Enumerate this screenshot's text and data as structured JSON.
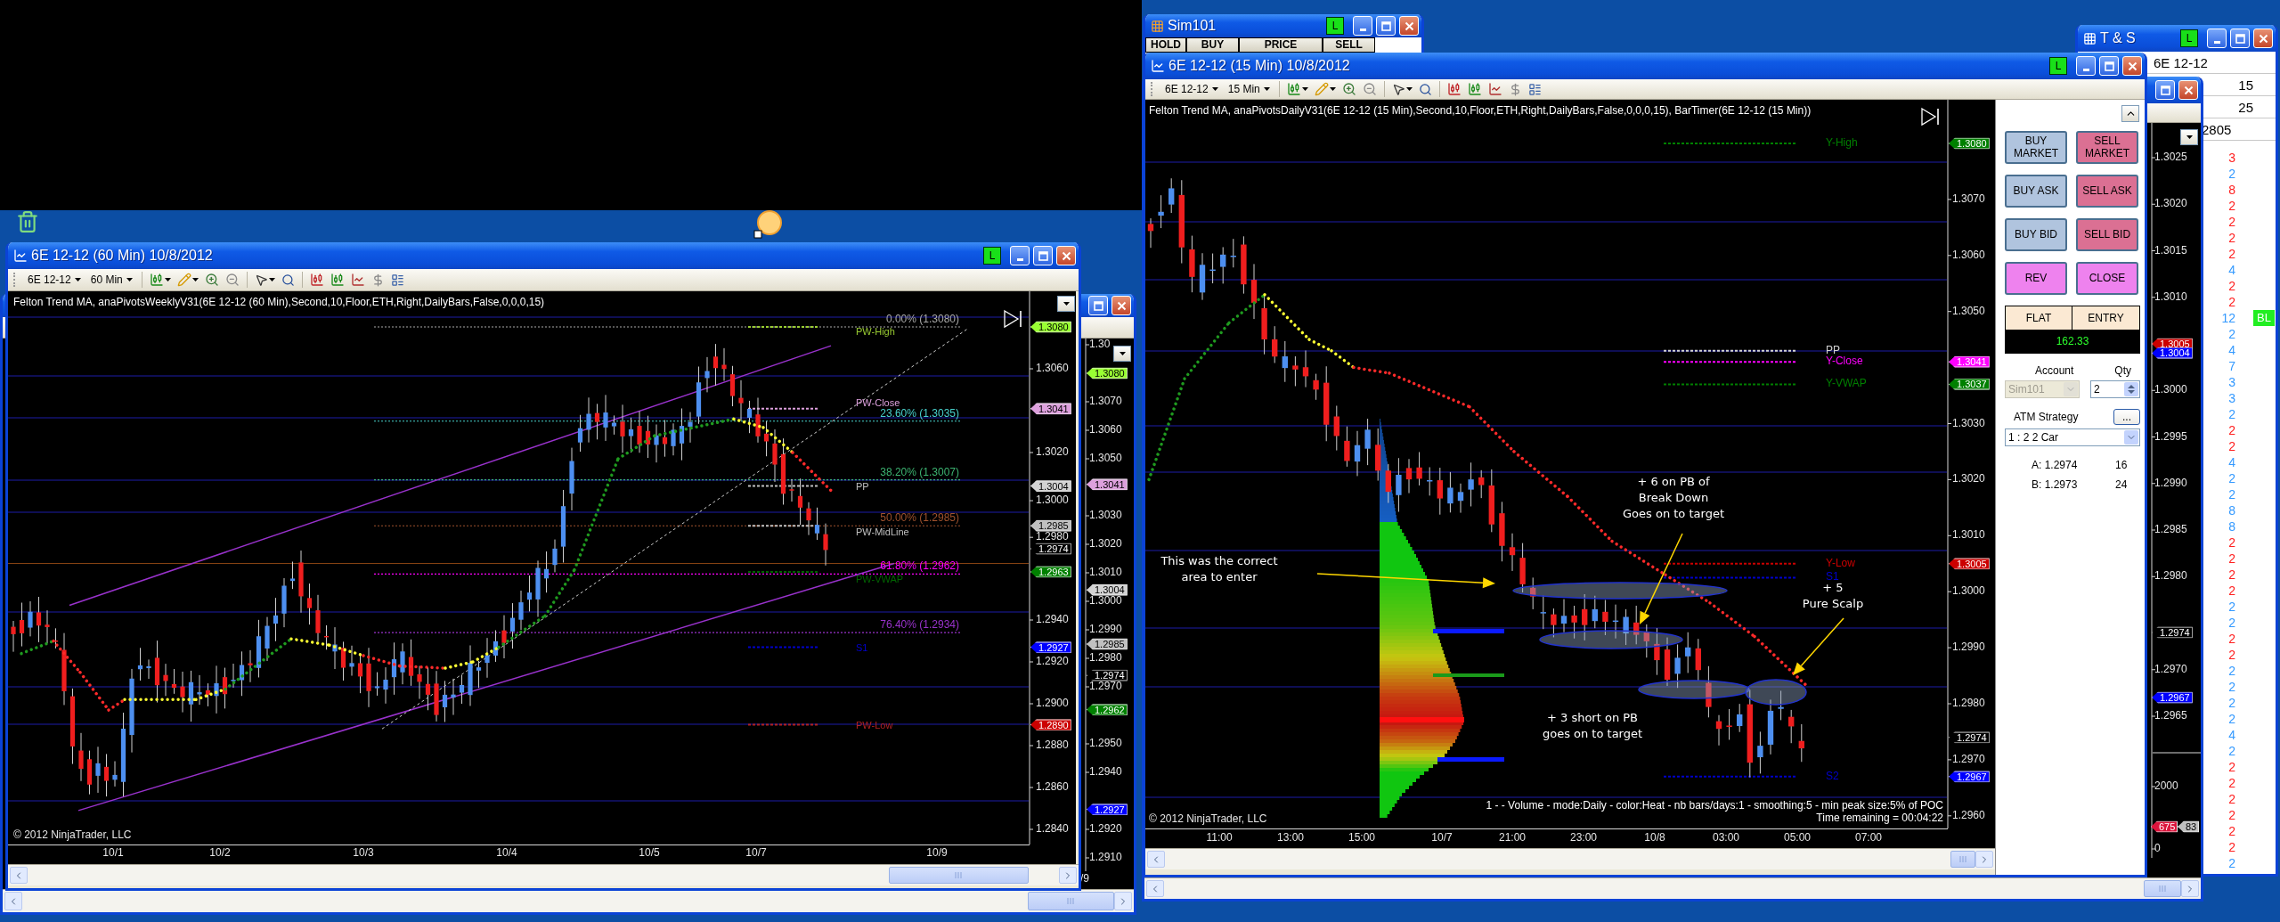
{
  "sim101_window": {
    "title": "Sim101",
    "status": "L",
    "columns": [
      "HOLD",
      "BUY",
      "PRICE",
      "SELL"
    ]
  },
  "right_chart_window": {
    "title": "6E 12-12 (15 Min)  10/8/2012",
    "status": "L",
    "instrument": "6E 12-12",
    "interval": "15 Min",
    "indicators": "Felton Trend MA, anaPivotsDailyV31(6E 12-12 (15 Min),Second,10,Floor,ETH,Right,DailyBars,False,0,0,0,15), BarTimer(6E 12-12 (15 Min))",
    "y_ticks": [
      "1.3070",
      "1.3060",
      "1.3050",
      "1.3030",
      "1.3020",
      "1.3010",
      "1.3000",
      "1.2990",
      "1.2980",
      "1.2970",
      "1.2960"
    ],
    "x_ticks": [
      "11:00",
      "13:00",
      "15:00",
      "10/7",
      "21:00",
      "23:00",
      "10/8",
      "03:00",
      "05:00",
      "07:00"
    ],
    "price_tags": [
      {
        "text": "1.3080",
        "color": "#008000"
      },
      {
        "text": "1.3041",
        "color": "#ff00ff"
      },
      {
        "text": "1.3037",
        "color": "#008000"
      },
      {
        "text": "1.3005",
        "color": "#cc0000"
      },
      {
        "text": "1.2974",
        "color": "#000000"
      },
      {
        "text": "1.2967",
        "color": "#0000ff"
      }
    ],
    "level_labels": [
      {
        "text": "Y-High",
        "color": "#008000"
      },
      {
        "text": "PP",
        "color": "#d3d3d3"
      },
      {
        "text": "Y-Close",
        "color": "#ff00ff"
      },
      {
        "text": "Y-VWAP",
        "color": "#008000"
      },
      {
        "text": "Y-Low",
        "color": "#cc0000"
      },
      {
        "text": "S1",
        "color": "#0000cd"
      },
      {
        "text": "S2",
        "color": "#0000cd"
      }
    ],
    "annotations": [
      "This was the correct\narea to enter",
      "+ 6 on PB of\nBreak Down\nGoes on to target",
      "+ 5\nPure Scalp",
      "+ 3 short on PB\ngoes on to target"
    ],
    "volume_legend": "1 -  - Volume - mode:Daily - color:Heat - nb bars/days:1 - smoothing:5 - min peak size:5% of POC",
    "time_remaining": "Time remaining = 00:04:22",
    "copyright": "© 2012 NinjaTrader, LLC",
    "order_panel": {
      "buttons": [
        {
          "label": "BUY MARKET",
          "color": "#b0c4de"
        },
        {
          "label": "SELL MARKET",
          "color": "#db7093"
        },
        {
          "label": "BUY ASK",
          "color": "#b0c4de"
        },
        {
          "label": "SELL ASK",
          "color": "#db7093"
        },
        {
          "label": "BUY BID",
          "color": "#b0c4de"
        },
        {
          "label": "SELL BID",
          "color": "#db7093"
        },
        {
          "label": "REV",
          "color": "#ee82ee"
        },
        {
          "label": "CLOSE",
          "color": "#ee82ee"
        }
      ],
      "position": "FLAT",
      "entry_label": "ENTRY",
      "pnl": "162.33",
      "account_label": "Account",
      "qty_label": "Qty",
      "account": {
        "value": "Sim101",
        "disabled": true
      },
      "qty": "2",
      "atm_label": "ATM Strategy",
      "atm_more": "...",
      "atm_strategy": "1 : 2  2 Car",
      "quotes": [
        {
          "label": "A: 1.2974",
          "size": "16"
        },
        {
          "label": "B: 1.2973",
          "size": "24"
        }
      ]
    }
  },
  "middle_chart_window": {
    "y_ticks": [
      "1.3025",
      "1.3020",
      "1.3015",
      "1.3010",
      "1.3000",
      "1.2995",
      "1.2990",
      "1.2985",
      "1.2980",
      "1.2970",
      "1.2965"
    ],
    "price_tags": [
      {
        "text": "1.3005",
        "color": "#cc0000"
      },
      {
        "text": "1.3004",
        "color": "#0000ff"
      },
      {
        "text": "1.2974",
        "color": "#000000"
      },
      {
        "text": "1.2967",
        "color": "#0000ff"
      }
    ],
    "volume_ticks": [
      "2000",
      "0"
    ],
    "volume_tags": [
      {
        "text": "675",
        "color": "#dc143c"
      },
      {
        "text": "83",
        "color": "#c0c0c0"
      }
    ]
  },
  "time_and_sales_window": {
    "title": "T & S",
    "status": "L",
    "instrument": "6E 12-12",
    "rows": [
      "15",
      "25"
    ],
    "last": "2805",
    "trades": [
      {
        "size": "3",
        "color": "#ff2020"
      },
      {
        "size": "2",
        "color": "#3399ff"
      },
      {
        "size": "8",
        "color": "#ff2020"
      },
      {
        "size": "2",
        "color": "#ff2020"
      },
      {
        "size": "2",
        "color": "#ff2020"
      },
      {
        "size": "2",
        "color": "#ff2020"
      },
      {
        "size": "2",
        "color": "#ff2020"
      },
      {
        "size": "4",
        "color": "#3399ff"
      },
      {
        "size": "2",
        "color": "#ff2020"
      },
      {
        "size": "2",
        "color": "#ff2020"
      },
      {
        "size": "12",
        "color": "#3399ff",
        "badge": "BL"
      },
      {
        "size": "2",
        "color": "#3399ff"
      },
      {
        "size": "4",
        "color": "#3399ff"
      },
      {
        "size": "7",
        "color": "#3399ff"
      },
      {
        "size": "3",
        "color": "#3399ff"
      },
      {
        "size": "3",
        "color": "#3399ff"
      },
      {
        "size": "2",
        "color": "#3399ff"
      },
      {
        "size": "2",
        "color": "#ff2020"
      },
      {
        "size": "2",
        "color": "#ff2020"
      },
      {
        "size": "4",
        "color": "#3399ff"
      },
      {
        "size": "2",
        "color": "#3399ff"
      },
      {
        "size": "2",
        "color": "#3399ff"
      },
      {
        "size": "8",
        "color": "#3399ff"
      },
      {
        "size": "8",
        "color": "#3399ff"
      },
      {
        "size": "2",
        "color": "#ff2020"
      },
      {
        "size": "2",
        "color": "#ff2020"
      },
      {
        "size": "2",
        "color": "#ff2020"
      },
      {
        "size": "2",
        "color": "#ff2020"
      },
      {
        "size": "2",
        "color": "#3399ff"
      },
      {
        "size": "2",
        "color": "#3399ff"
      },
      {
        "size": "2",
        "color": "#ff2020"
      },
      {
        "size": "2",
        "color": "#ff2020"
      },
      {
        "size": "2",
        "color": "#3399ff"
      },
      {
        "size": "2",
        "color": "#3399ff"
      },
      {
        "size": "2",
        "color": "#3399ff"
      },
      {
        "size": "2",
        "color": "#3399ff"
      },
      {
        "size": "4",
        "color": "#3399ff"
      },
      {
        "size": "2",
        "color": "#3399ff"
      },
      {
        "size": "2",
        "color": "#ff2020"
      },
      {
        "size": "2",
        "color": "#ff2020"
      },
      {
        "size": "2",
        "color": "#ff2020"
      },
      {
        "size": "2",
        "color": "#ff2020"
      },
      {
        "size": "2",
        "color": "#ff2020"
      },
      {
        "size": "2",
        "color": "#ff2020"
      },
      {
        "size": "2",
        "color": "#3399ff"
      }
    ]
  },
  "left_chart_window": {
    "title": "6E 12-12 (60 Min)  10/8/2012",
    "status": "L",
    "instrument": "6E 12-12",
    "interval": "60 Min",
    "indicators": "Felton Trend MA, anaPivotsWeeklyV31(6E 12-12 (60 Min),Second,10,Floor,ETH,Right,DailyBars,False,0,0,0,15)",
    "y_ticks": [
      "1.3060",
      "1.3020",
      "1.3000",
      "1.2980",
      "1.2940",
      "1.2920",
      "1.2900",
      "1.2880",
      "1.2860",
      "1.2840"
    ],
    "x_ticks": [
      "10/1",
      "10/2",
      "10/3",
      "10/4",
      "10/5",
      "10/7",
      "10/9"
    ],
    "price_tags": [
      {
        "text": "1.3080",
        "color": "#99ff33"
      },
      {
        "text": "1.3041",
        "color": "#dda0dd"
      },
      {
        "text": "1.3004",
        "color": "#d3d3d3"
      },
      {
        "text": "1.2985",
        "color": "#c0c0c0"
      },
      {
        "text": "1.2974",
        "color": "#000000"
      },
      {
        "text": "1.2963",
        "color": "#008000"
      },
      {
        "text": "1.2927",
        "color": "#0000ff"
      },
      {
        "text": "1.2890",
        "color": "#cc0000"
      }
    ],
    "level_labels": [
      {
        "text": "PW-High",
        "color": "#9acd32"
      },
      {
        "text": "PW-Close",
        "color": "#dda0dd"
      },
      {
        "text": "PP",
        "color": "#c0c0c0"
      },
      {
        "text": "PW-MidLine",
        "color": "#c0c0c0"
      },
      {
        "text": "PW-VWAP",
        "color": "#006400"
      },
      {
        "text": "S1",
        "color": "#0000cd"
      },
      {
        "text": "PW-Low",
        "color": "#b22222"
      }
    ],
    "fib_labels": [
      {
        "text": "0.00% (1.3080)",
        "color": "#a9a9a9"
      },
      {
        "text": "23.60% (1.3035)",
        "color": "#48d1cc"
      },
      {
        "text": "38.20% (1.3007)",
        "color": "#3cb371"
      },
      {
        "text": "50.00% (1.2985)",
        "color": "#a0522d"
      },
      {
        "text": "61.80% (1.2962)",
        "color": "#ff00ff"
      },
      {
        "text": "76.40% (1.2934)",
        "color": "#9932cc"
      }
    ],
    "copyright": "© 2012 NinjaTrader, LLC"
  },
  "left_back_window": {
    "y_ticks": [
      "1.30",
      "1.3070",
      "1.3060",
      "1.3050",
      "1.3030",
      "1.3020",
      "1.3010",
      "1.3000",
      "1.2990",
      "1.2980",
      "1.2970",
      "1.2950",
      "1.2940",
      "1.2920",
      "1.2910"
    ],
    "price_tags": [
      {
        "text": "1.3080",
        "color": "#99ff33"
      },
      {
        "text": "1.3041",
        "color": "#dda0dd"
      },
      {
        "text": "1.3004",
        "color": "#d3d3d3"
      },
      {
        "text": "1.2985",
        "color": "#c0c0c0"
      },
      {
        "text": "1.2974",
        "color": "#000000"
      },
      {
        "text": "1.2962",
        "color": "#008000"
      },
      {
        "text": "1.2927",
        "color": "#0000ff"
      }
    ],
    "x_ticks": [
      "/9"
    ]
  }
}
